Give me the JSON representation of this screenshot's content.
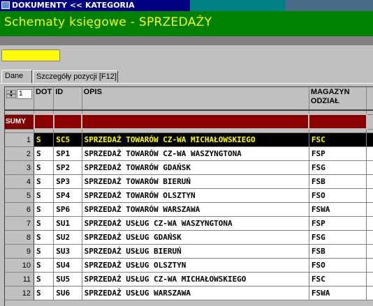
{
  "window": {
    "title": "DOKUMENTY << KATEGORIA",
    "icon": "app-icon"
  },
  "header": {
    "title": "Schematy księgowe - SPRZEDAŻY"
  },
  "filter": {
    "value": ""
  },
  "tabs": [
    {
      "label": "Dane",
      "active": true
    },
    {
      "label": "Szczegóły pozycji [F12]",
      "active": false
    }
  ],
  "grid": {
    "spinner_value": "1",
    "columns": {
      "dot": "DOT",
      "id": "ID",
      "opis": "OPIS",
      "magazyn": "MAGAZYN ODZIAŁ"
    },
    "sumy_label": "SUMY",
    "rows": [
      {
        "n": "1",
        "dot": "S",
        "id": "SC5",
        "opis": "SPRZEDAŻ TOWARÓW CZ-WA MICHAŁOWSKIEGO",
        "mag": "FSC"
      },
      {
        "n": "2",
        "dot": "S",
        "id": "SP1",
        "opis": "SPRZEDAŻ TOWARÓW CZ-WA WASZYNGTONA",
        "mag": "FSP"
      },
      {
        "n": "3",
        "dot": "S",
        "id": "SP2",
        "opis": "SPRZEDAŻ TOWARÓW GDAŃSK",
        "mag": "FSG"
      },
      {
        "n": "4",
        "dot": "S",
        "id": "SP3",
        "opis": "SPRZEDAŻ TOWARÓW BIERUŃ",
        "mag": "FSB"
      },
      {
        "n": "5",
        "dot": "S",
        "id": "SP4",
        "opis": "SPRZEDAŻ TOWARÓW OLSZTYN",
        "mag": "FSO"
      },
      {
        "n": "6",
        "dot": "S",
        "id": "SP6",
        "opis": "SPRZEDAŻ TOWARÓW WARSZAWA",
        "mag": "FSWA"
      },
      {
        "n": "7",
        "dot": "S",
        "id": "SU1",
        "opis": "SPRZEDAŻ USŁUG CZ-WA WASZYNGTONA",
        "mag": "FSP"
      },
      {
        "n": "8",
        "dot": "S",
        "id": "SU2",
        "opis": "SPRZEDAŻ USŁUG GDAŃSK",
        "mag": "FSG"
      },
      {
        "n": "9",
        "dot": "S",
        "id": "SU3",
        "opis": "SPRZEDAŻ USŁUG BIERUŃ",
        "mag": "FSB"
      },
      {
        "n": "10",
        "dot": "S",
        "id": "SU4",
        "opis": "SPRZEDAŻ USŁUG OLSZTYN",
        "mag": "FSO"
      },
      {
        "n": "11",
        "dot": "S",
        "id": "SU5",
        "opis": "SPRZEDAŻ USŁUG CZ-WA MICHAŁOWSKIEGO",
        "mag": "FSC"
      },
      {
        "n": "12",
        "dot": "S",
        "id": "SU6",
        "opis": "SPRZEDAŻ USŁUG WARSZAWA",
        "mag": "FSWA"
      }
    ],
    "selected_row": "1"
  },
  "colors": {
    "title_bg": "#000080",
    "header_bg": "#008000",
    "header_text": "#ffff00",
    "sumy_bg": "#8b0000",
    "selected_bg": "#000000",
    "selected_text": "#ffff00"
  }
}
